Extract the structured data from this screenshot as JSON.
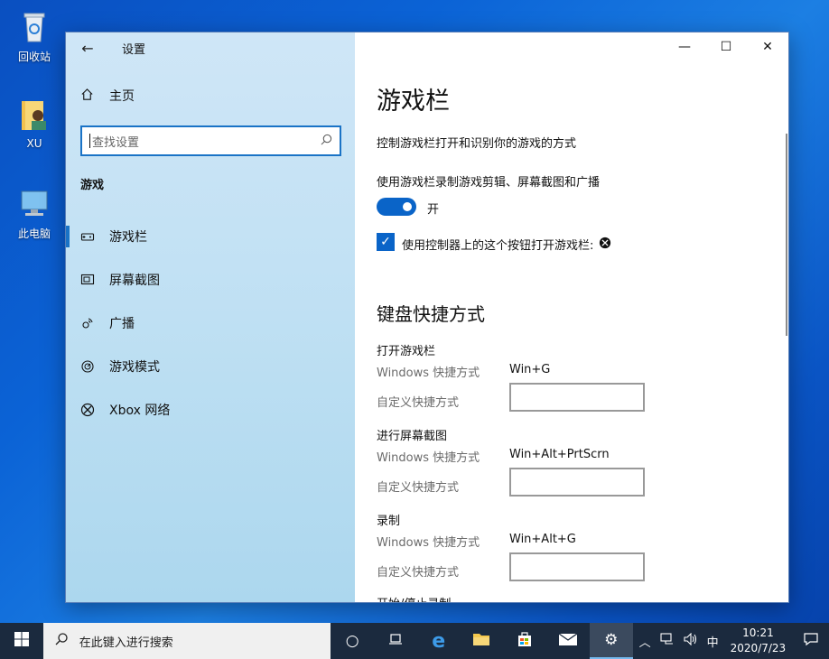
{
  "desktop": {
    "icons": [
      {
        "label": "回收站"
      },
      {
        "label": "XU"
      },
      {
        "label": "此电脑"
      }
    ]
  },
  "window": {
    "title": "设置",
    "back_glyph": "←",
    "controls": {
      "minimize": "—",
      "maximize": "☐",
      "close": "✕"
    }
  },
  "sidebar": {
    "home_label": "主页",
    "search_placeholder": "查找设置",
    "section_title": "游戏",
    "items": [
      {
        "label": "游戏栏",
        "icon": "game-bar-icon",
        "active": true
      },
      {
        "label": "屏幕截图",
        "icon": "capture-icon"
      },
      {
        "label": "广播",
        "icon": "broadcast-icon"
      },
      {
        "label": "游戏模式",
        "icon": "game-mode-icon"
      },
      {
        "label": "Xbox 网络",
        "icon": "xbox-icon"
      }
    ]
  },
  "main": {
    "title": "游戏栏",
    "description": "控制游戏栏打开和识别你的游戏的方式",
    "toggle_setting_label": "使用游戏栏录制游戏剪辑、屏幕截图和广播",
    "toggle_state": "开",
    "checkbox_label": "使用控制器上的这个按钮打开游戏栏:",
    "shortcuts_title": "键盘快捷方式",
    "windows_shortcut_label": "Windows 快捷方式",
    "custom_shortcut_label": "自定义快捷方式",
    "groups": [
      {
        "title": "打开游戏栏",
        "shortcut": "Win+G"
      },
      {
        "title": "进行屏幕截图",
        "shortcut": "Win+Alt+PrtScrn"
      },
      {
        "title": "录制",
        "shortcut": "Win+Alt+G"
      }
    ],
    "next_group_title": "开始/停止录制"
  },
  "taskbar": {
    "search_placeholder": "在此键入进行搜索",
    "tray_ime": "中",
    "time": "10:21",
    "date": "2020/7/23"
  },
  "colors": {
    "accent": "#0a64c8",
    "taskbar": "#1b2a3e"
  }
}
